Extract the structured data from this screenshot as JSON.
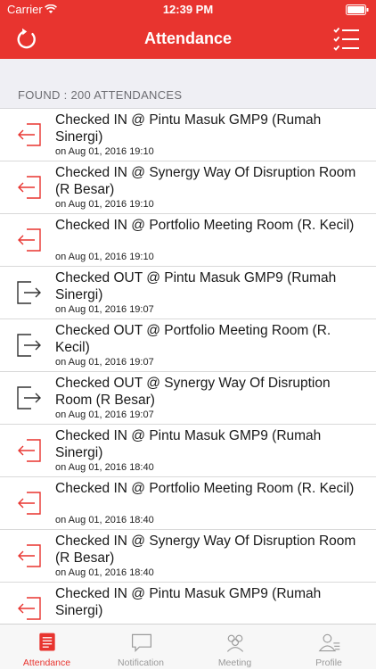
{
  "status_bar": {
    "carrier": "Carrier",
    "time": "12:39 PM"
  },
  "nav": {
    "title": "Attendance",
    "left_icon": "refresh-icon",
    "right_icon": "checklist-icon"
  },
  "section": {
    "header": "FOUND : 200 ATTENDANCES"
  },
  "colors": {
    "accent": "#e8342f",
    "check_in": "#e8342f",
    "check_out": "#333333",
    "tab_inactive": "#9a9a9a"
  },
  "attendances": [
    {
      "type": "in",
      "icon": "check-in-icon",
      "title": "Checked IN @ Pintu Masuk GMP9 (Rumah Sinergi)",
      "time": "on Aug 01, 2016 19:10"
    },
    {
      "type": "in",
      "icon": "check-in-icon",
      "title": "Checked IN @ Synergy Way Of Disruption Room (R Besar)",
      "time": "on Aug 01, 2016 19:10"
    },
    {
      "type": "in",
      "icon": "check-in-icon",
      "title": "Checked IN @ Portfolio Meeting Room (R. Kecil)",
      "time": "on Aug 01, 2016 19:10"
    },
    {
      "type": "out",
      "icon": "check-out-icon",
      "title": "Checked OUT @ Pintu Masuk GMP9 (Rumah Sinergi)",
      "time": "on Aug 01, 2016 19:07"
    },
    {
      "type": "out",
      "icon": "check-out-icon",
      "title": "Checked OUT @ Portfolio Meeting Room (R. Kecil)",
      "time": "on Aug 01, 2016 19:07"
    },
    {
      "type": "out",
      "icon": "check-out-icon",
      "title": "Checked OUT @ Synergy Way Of Disruption Room (R Besar)",
      "time": "on Aug 01, 2016 19:07"
    },
    {
      "type": "in",
      "icon": "check-in-icon",
      "title": "Checked IN @ Pintu Masuk GMP9 (Rumah Sinergi)",
      "time": "on Aug 01, 2016 18:40"
    },
    {
      "type": "in",
      "icon": "check-in-icon",
      "title": "Checked IN @ Portfolio Meeting Room (R. Kecil)",
      "time": "on Aug 01, 2016 18:40"
    },
    {
      "type": "in",
      "icon": "check-in-icon",
      "title": "Checked IN @ Synergy Way Of Disruption Room (R Besar)",
      "time": "on Aug 01, 2016 18:40"
    },
    {
      "type": "in",
      "icon": "check-in-icon",
      "title": "Checked IN @ Pintu Masuk GMP9 (Rumah Sinergi)",
      "time": ""
    }
  ],
  "tabs": [
    {
      "label": "Attendance",
      "icon": "attendance-icon",
      "active": true
    },
    {
      "label": "Notification",
      "icon": "notification-icon",
      "active": false
    },
    {
      "label": "Meeting",
      "icon": "meeting-icon",
      "active": false
    },
    {
      "label": "Profile",
      "icon": "profile-icon",
      "active": false
    }
  ]
}
